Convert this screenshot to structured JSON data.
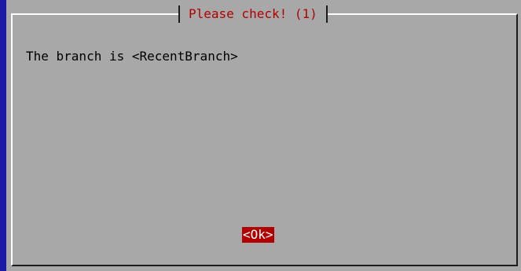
{
  "dialog": {
    "title": "Please check! (1)",
    "message": "The branch is <RecentBranch>",
    "ok_button_label": "<Ok>"
  },
  "colors": {
    "background": "#1a1aa6",
    "dialog_background": "#a8a8a8",
    "title_text": "#b00000",
    "button_background": "#b00000",
    "button_text": "#ffffff",
    "message_text": "#000000"
  }
}
